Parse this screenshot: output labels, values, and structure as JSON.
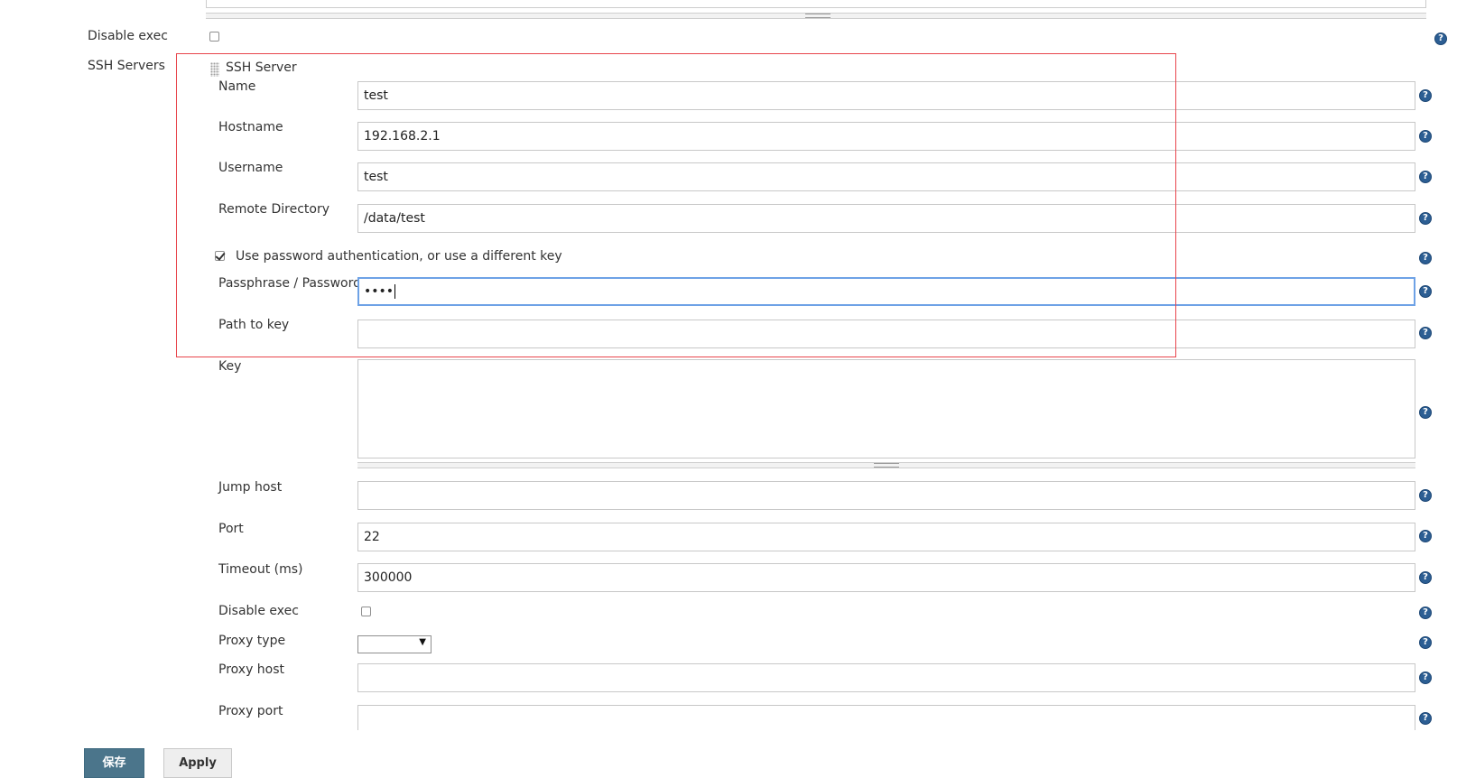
{
  "global": {
    "disable_exec_label": "Disable exec",
    "ssh_servers_label": "SSH Servers"
  },
  "ssh_server": {
    "title": "SSH Server",
    "fields": {
      "name": {
        "label": "Name",
        "value": "test"
      },
      "hostname": {
        "label": "Hostname",
        "value": "192.168.2.1"
      },
      "username": {
        "label": "Username",
        "value": "test"
      },
      "remote_directory": {
        "label": "Remote Directory",
        "value": "/data/test"
      },
      "use_password_auth": {
        "label": "Use password authentication, or use a different key",
        "checked": true
      },
      "passphrase": {
        "label": "Passphrase / Password",
        "value": "••••"
      },
      "path_to_key": {
        "label": "Path to key",
        "value": ""
      },
      "key": {
        "label": "Key",
        "value": ""
      },
      "jump_host": {
        "label": "Jump host",
        "value": ""
      },
      "port": {
        "label": "Port",
        "value": "22"
      },
      "timeout": {
        "label": "Timeout (ms)",
        "value": "300000"
      },
      "disable_exec": {
        "label": "Disable exec",
        "checked": false
      },
      "proxy_type": {
        "label": "Proxy type",
        "selected": ""
      },
      "proxy_host": {
        "label": "Proxy host",
        "value": ""
      },
      "proxy_port": {
        "label": "Proxy port",
        "value": ""
      }
    }
  },
  "help_icon_glyph": "?",
  "buttons": {
    "save": "保存",
    "apply": "Apply"
  },
  "colors": {
    "highlight_border": "#e8454c",
    "save_button_bg": "#4b758b",
    "help_icon": "#2c5e93",
    "focus_border": "#6ea2e6"
  }
}
